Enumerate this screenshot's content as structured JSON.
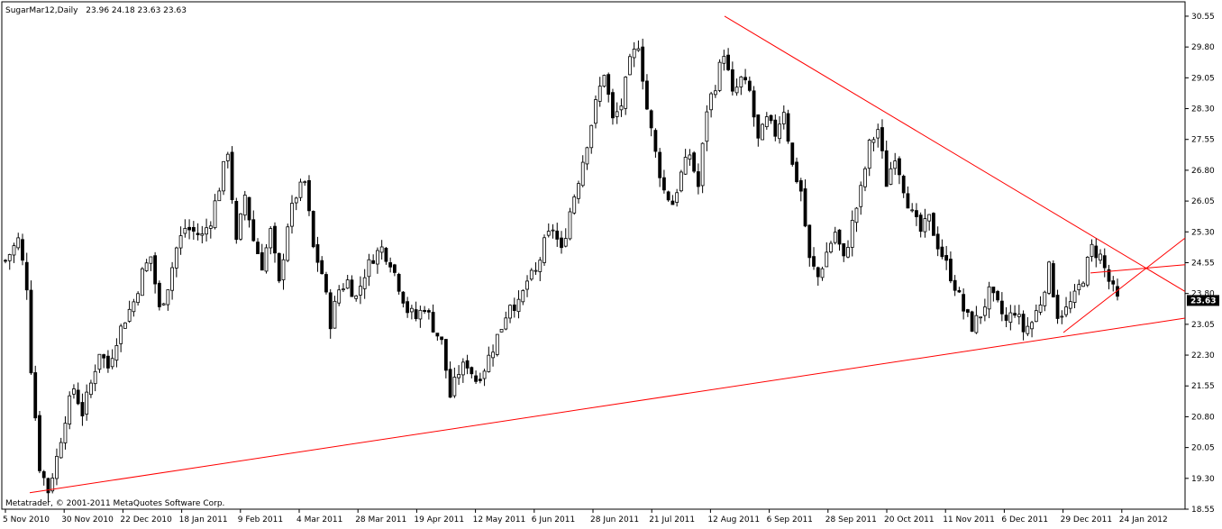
{
  "header": {
    "symbol": "SugarMar12,Daily",
    "ohlc": "23.96 24.18 23.63 23.63"
  },
  "footer": {
    "copyright": "Metatrader, © 2001-2011 MetaQuotes Software Corp."
  },
  "colors": {
    "background": "#ffffff",
    "frame": "#000000",
    "bull_candle": "#000000",
    "bear_candle": "#000000",
    "trendline": "#ff0000",
    "price_label_bg": "#000000",
    "price_label_text": "#ffffff"
  },
  "chart_data": {
    "type": "candlestick",
    "title": "SugarMar12,Daily",
    "ylim": [
      18.55,
      30.9
    ],
    "y_ticks": [
      30.55,
      29.8,
      29.05,
      28.3,
      27.55,
      26.8,
      26.05,
      25.3,
      24.55,
      23.8,
      23.05,
      22.3,
      21.55,
      20.8,
      20.05,
      19.3,
      18.55
    ],
    "x_ticks": [
      "5 Nov 2010",
      "30 Nov 2010",
      "22 Dec 2010",
      "18 Jan 2011",
      "9 Feb 2011",
      "4 Mar 2011",
      "28 Mar 2011",
      "19 Apr 2011",
      "12 May 2011",
      "6 Jun 2011",
      "28 Jun 2011",
      "21 Jul 2011",
      "12 Aug 2011",
      "6 Sep 2011",
      "28 Sep 2011",
      "20 Oct 2011",
      "11 Nov 2011",
      "6 Dec 2011",
      "29 Dec 2011",
      "24 Jan 2012"
    ],
    "last_price": "23.63",
    "price_path": [
      [
        0,
        24.6
      ],
      [
        3,
        25.1
      ],
      [
        5,
        24.0
      ],
      [
        6,
        22.0
      ],
      [
        8,
        19.6
      ],
      [
        10,
        19.0
      ],
      [
        12,
        19.8
      ],
      [
        14,
        20.8
      ],
      [
        16,
        21.5
      ],
      [
        18,
        20.9
      ],
      [
        20,
        21.6
      ],
      [
        22,
        22.4
      ],
      [
        24,
        22.0
      ],
      [
        26,
        22.7
      ],
      [
        28,
        23.2
      ],
      [
        30,
        23.6
      ],
      [
        32,
        24.3
      ],
      [
        34,
        24.7
      ],
      [
        36,
        23.4
      ],
      [
        38,
        24.0
      ],
      [
        40,
        24.9
      ],
      [
        42,
        25.4
      ],
      [
        44,
        25.3
      ],
      [
        46,
        25.2
      ],
      [
        48,
        25.6
      ],
      [
        50,
        26.4
      ],
      [
        52,
        27.3
      ],
      [
        54,
        25.0
      ],
      [
        56,
        26.2
      ],
      [
        58,
        25.1
      ],
      [
        60,
        24.5
      ],
      [
        62,
        25.3
      ],
      [
        64,
        24.0
      ],
      [
        66,
        25.5
      ],
      [
        68,
        26.2
      ],
      [
        70,
        26.5
      ],
      [
        72,
        24.9
      ],
      [
        74,
        24.3
      ],
      [
        76,
        23.1
      ],
      [
        78,
        23.9
      ],
      [
        80,
        24.1
      ],
      [
        82,
        23.7
      ],
      [
        84,
        24.3
      ],
      [
        86,
        24.7
      ],
      [
        88,
        24.9
      ],
      [
        90,
        24.6
      ],
      [
        92,
        24.0
      ],
      [
        94,
        23.4
      ],
      [
        96,
        23.2
      ],
      [
        98,
        23.5
      ],
      [
        100,
        23.0
      ],
      [
        102,
        22.6
      ],
      [
        104,
        21.3
      ],
      [
        106,
        21.9
      ],
      [
        108,
        22.1
      ],
      [
        110,
        21.7
      ],
      [
        112,
        22.0
      ],
      [
        114,
        22.5
      ],
      [
        116,
        23.0
      ],
      [
        118,
        23.6
      ],
      [
        120,
        23.5
      ],
      [
        122,
        24.1
      ],
      [
        124,
        24.3
      ],
      [
        126,
        25.0
      ],
      [
        128,
        25.4
      ],
      [
        130,
        24.8
      ],
      [
        132,
        25.8
      ],
      [
        134,
        26.6
      ],
      [
        136,
        27.5
      ],
      [
        138,
        28.4
      ],
      [
        140,
        29.2
      ],
      [
        142,
        28.0
      ],
      [
        144,
        28.4
      ],
      [
        146,
        29.4
      ],
      [
        148,
        29.9
      ],
      [
        150,
        28.3
      ],
      [
        152,
        27.2
      ],
      [
        154,
        26.3
      ],
      [
        156,
        26.0
      ],
      [
        158,
        26.7
      ],
      [
        160,
        27.2
      ],
      [
        162,
        26.4
      ],
      [
        164,
        28.3
      ],
      [
        166,
        28.9
      ],
      [
        168,
        29.7
      ],
      [
        170,
        28.6
      ],
      [
        172,
        29.0
      ],
      [
        174,
        28.7
      ],
      [
        176,
        27.5
      ],
      [
        178,
        28.0
      ],
      [
        180,
        27.7
      ],
      [
        182,
        28.3
      ],
      [
        184,
        26.9
      ],
      [
        186,
        26.3
      ],
      [
        188,
        24.6
      ],
      [
        190,
        24.2
      ],
      [
        192,
        24.8
      ],
      [
        194,
        25.3
      ],
      [
        196,
        24.6
      ],
      [
        198,
        25.5
      ],
      [
        200,
        26.3
      ],
      [
        202,
        27.4
      ],
      [
        204,
        27.8
      ],
      [
        206,
        26.5
      ],
      [
        208,
        27.2
      ],
      [
        210,
        26.4
      ],
      [
        212,
        25.7
      ],
      [
        214,
        25.3
      ],
      [
        216,
        25.6
      ],
      [
        218,
        25.0
      ],
      [
        220,
        24.5
      ],
      [
        222,
        24.0
      ],
      [
        224,
        23.4
      ],
      [
        226,
        23.0
      ],
      [
        228,
        23.3
      ],
      [
        230,
        23.8
      ],
      [
        232,
        23.5
      ],
      [
        234,
        23.1
      ],
      [
        236,
        23.4
      ],
      [
        238,
        22.9
      ],
      [
        240,
        23.1
      ],
      [
        242,
        23.6
      ],
      [
        244,
        24.4
      ],
      [
        246,
        23.3
      ],
      [
        248,
        23.4
      ],
      [
        250,
        23.7
      ],
      [
        252,
        24.2
      ],
      [
        254,
        24.9
      ],
      [
        256,
        24.7
      ],
      [
        258,
        24.1
      ],
      [
        260,
        23.63
      ]
    ],
    "trendlines": [
      {
        "from": [
          30.55,
          "12 Aug 2011"
        ],
        "to": [
          23.85,
          "extended"
        ]
      },
      {
        "from": [
          18.95,
          "30 Nov 2010"
        ],
        "to": [
          23.2,
          "extended"
        ]
      },
      {
        "from": [
          22.85,
          "29 Dec 2011"
        ],
        "to": [
          25.15,
          "extended"
        ]
      },
      {
        "from": [
          24.3,
          "24 Jan 2012"
        ],
        "to": [
          24.5,
          "extended"
        ]
      }
    ]
  }
}
